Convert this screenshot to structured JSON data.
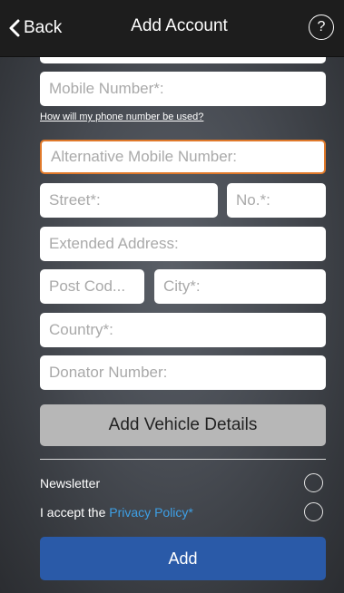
{
  "header": {
    "back_label": "Back",
    "title": "Add Account",
    "help_label": "?"
  },
  "form": {
    "mobile_placeholder": "Mobile Number*:",
    "phone_hint": "How will my phone number be used?",
    "alt_mobile_placeholder": "Alternative Mobile Number:",
    "street_placeholder": "Street*:",
    "number_placeholder": "No.*:",
    "extended_placeholder": "Extended Address:",
    "postcode_placeholder": "Post Cod...",
    "city_placeholder": "City*:",
    "country_placeholder": "Country*:",
    "donator_placeholder": "Donator Number:"
  },
  "vehicle_button": "Add Vehicle Details",
  "options": {
    "newsletter_label": "Newsletter",
    "privacy_prefix": "I accept the ",
    "privacy_link": "Privacy Policy",
    "privacy_suffix": "*"
  },
  "add_button": "Add",
  "colors": {
    "accent_focus": "#e0792a",
    "primary_button": "#2a5aa8",
    "link": "#3ea0e6"
  }
}
